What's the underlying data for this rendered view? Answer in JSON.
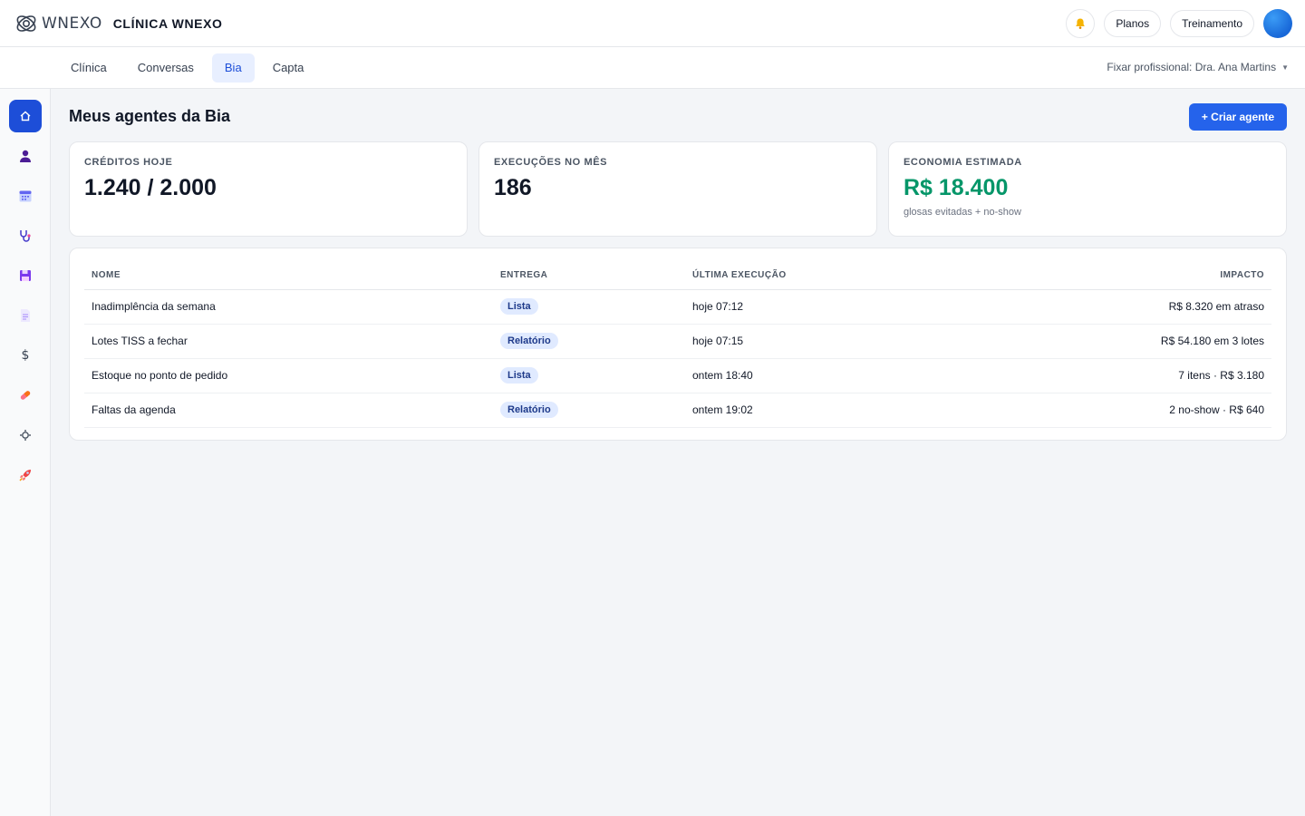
{
  "brand": {
    "logo_text": "WNEXO",
    "clinic_name": "CLÍNICA WNEXO"
  },
  "header": {
    "plans_label": "Planos",
    "training_label": "Treinamento"
  },
  "tabs": [
    {
      "label": "Clínica",
      "active": false
    },
    {
      "label": "Conversas",
      "active": false
    },
    {
      "label": "Bia",
      "active": true
    },
    {
      "label": "Capta",
      "active": false
    }
  ],
  "pin_professional": "Fixar profissional: Dra. Ana Martins",
  "sidebar": {
    "items": [
      {
        "icon": "home-icon",
        "active": true
      },
      {
        "icon": "user-icon",
        "active": false
      },
      {
        "icon": "calendar-icon",
        "active": false
      },
      {
        "icon": "stethoscope-icon",
        "active": false
      },
      {
        "icon": "save-icon",
        "active": false
      },
      {
        "icon": "document-icon",
        "active": false
      },
      {
        "icon": "dollar-icon",
        "active": false
      },
      {
        "icon": "pill-icon",
        "active": false
      },
      {
        "icon": "gear-icon",
        "active": false
      },
      {
        "icon": "rocket-icon",
        "active": false
      }
    ]
  },
  "main": {
    "title": "Meus agentes da Bia",
    "create_label": "+ Criar agente",
    "stats": [
      {
        "label": "CRÉDITOS HOJE",
        "value": "1.240 / 2.000",
        "sub": ""
      },
      {
        "label": "EXECUÇÕES NO MÊS",
        "value": "186",
        "sub": ""
      },
      {
        "label": "ECONOMIA ESTIMADA",
        "value": "R$ 18.400",
        "sub": "glosas evitadas + no-show"
      }
    ],
    "table": {
      "headers": [
        "NOME",
        "ENTREGA",
        "ÚLTIMA EXECUÇÃO",
        "IMPACTO"
      ],
      "rows": [
        {
          "name": "Inadimplência da semana",
          "delivery": "Lista",
          "last_run": "hoje 07:12",
          "impact": "R$ 8.320 em atraso"
        },
        {
          "name": "Lotes TISS a fechar",
          "delivery": "Relatório",
          "last_run": "hoje 07:15",
          "impact": "R$ 54.180 em 3 lotes"
        },
        {
          "name": "Estoque no ponto de pedido",
          "delivery": "Lista",
          "last_run": "ontem 18:40",
          "impact": "7 itens · R$ 3.180"
        },
        {
          "name": "Faltas da agenda",
          "delivery": "Relatório",
          "last_run": "ontem 19:02",
          "impact": "2 no-show · R$ 640"
        }
      ]
    }
  },
  "colors": {
    "accent": "#2563eb",
    "positive": "#059669",
    "active_tab_bg": "#e8efff"
  }
}
